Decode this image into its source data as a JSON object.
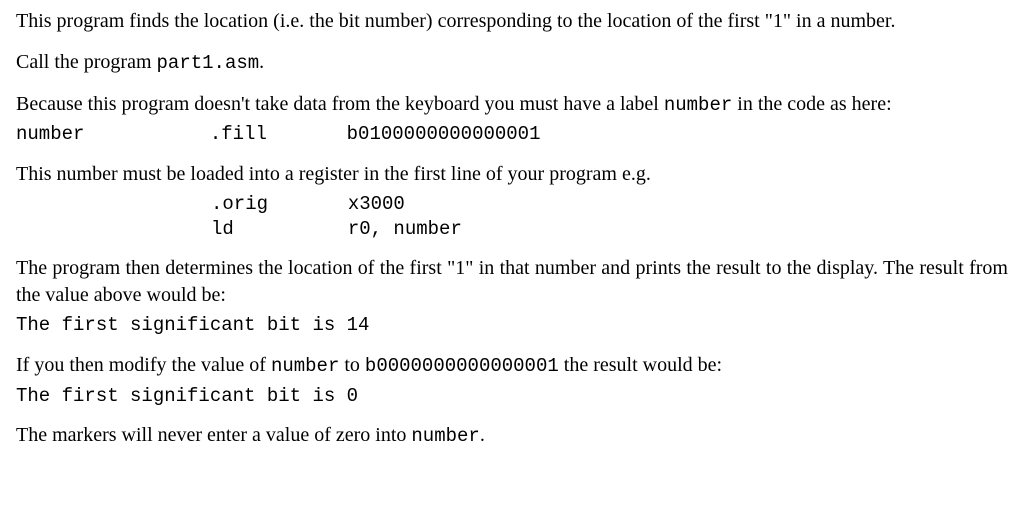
{
  "p1a": "This program finds the location (i.e. the bit number) corresponding to the location of the first \"1\" in a number.",
  "p2a": "Call the program ",
  "p2code": "part1.asm",
  "p2b": ".",
  "p3a": "Because this program doesn't take data from the keyboard you must have a label ",
  "p3code": "number",
  "p3b": " in the code as here:",
  "codeblock1": "number           .fill       b0100000000000001",
  "p4": "This number must be loaded into a register in the first line of your program e.g.",
  "codeblock2": ".orig       x3000\nld          r0, number",
  "p5": "The program then determines the location of the first \"1\" in that number and prints the result to the display. The result from the value above would be:",
  "codeblock3": "The first significant bit is 14",
  "p6a": "If you then modify the value of ",
  "p6code1": "number",
  "p6b": " to ",
  "p6code2": "b0000000000000001",
  "p6c": " the result would be:",
  "codeblock4": "The first significant bit is 0",
  "p7a": "The markers will never enter a value of zero into ",
  "p7code": "number",
  "p7b": "."
}
